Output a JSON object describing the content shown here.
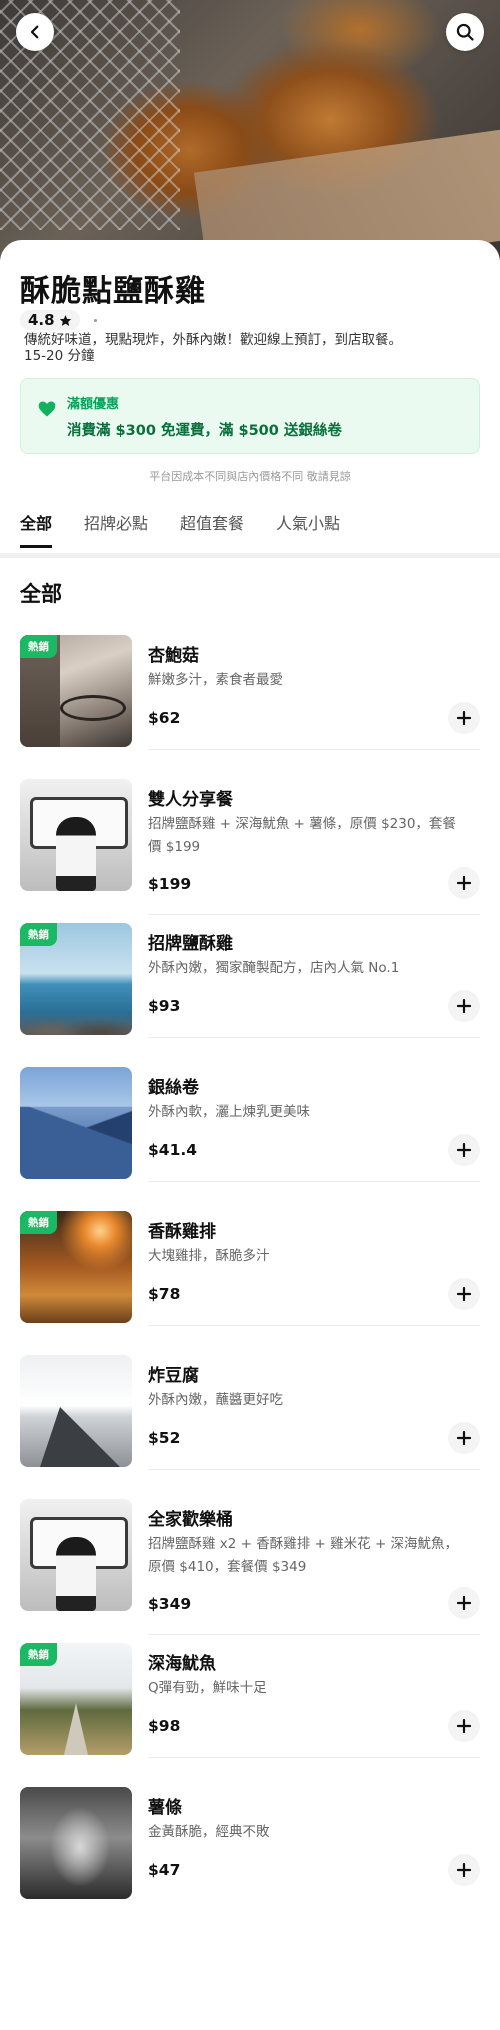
{
  "store": {
    "name": "酥脆點鹽酥雞",
    "rating": "4.8",
    "description": "傳統好味道，現點現炸，外酥內嫩！歡迎線上預訂，到店取餐。",
    "eta": "15-20 分鐘"
  },
  "promo": {
    "title": "滿額優惠",
    "text": "消費滿 $300 免運費，滿 $500 送銀絲卷",
    "accent_color": "#06a45b"
  },
  "disclaimer": "平台因成本不同與店內價格不同 敬請見諒",
  "tabs": [
    {
      "label": "全部"
    },
    {
      "label": "招牌必點"
    },
    {
      "label": "超值套餐"
    },
    {
      "label": "人氣小點"
    }
  ],
  "section_title": "全部",
  "badge_label": "熱銷",
  "icons": {
    "back": "chevron-left-icon",
    "search": "search-icon",
    "rating": "star-icon",
    "promo": "heart-icon",
    "add": "plus-icon"
  },
  "items": [
    {
      "name": "杏鮑菇",
      "desc": "鮮嫩多汁，素食者最愛",
      "price": "$62",
      "hot": true,
      "image": "street-photo"
    },
    {
      "name": "雙人分享餐",
      "desc": "招牌鹽酥雞 + 深海魷魚 + 薯條，原價 $230，套餐價 $199",
      "price": "$199",
      "hot": false,
      "image": "subway-photo"
    },
    {
      "name": "招牌鹽酥雞",
      "desc": "外酥內嫩，獨家醃製配方，店內人氣 No.1",
      "price": "$93",
      "hot": true,
      "image": "sea-photo"
    },
    {
      "name": "銀絲卷",
      "desc": "外酥內軟，灑上煉乳更美味",
      "price": "$41.4",
      "hot": false,
      "image": "mountain-photo"
    },
    {
      "name": "香酥雞排",
      "desc": "大塊雞排，酥脆多汁",
      "price": "$78",
      "hot": true,
      "image": "field-photo"
    },
    {
      "name": "炸豆腐",
      "desc": "外酥內嫩，蘸醬更好吃",
      "price": "$52",
      "hot": false,
      "image": "road-photo"
    },
    {
      "name": "全家歡樂桶",
      "desc": "招牌鹽酥雞 x2 + 香酥雞排 + 雞米花 + 深海魷魚，原價 $410，套餐價 $349",
      "price": "$349",
      "hot": false,
      "image": "subway-photo"
    },
    {
      "name": "深海魷魚",
      "desc": "Q彈有勁，鮮味十足",
      "price": "$98",
      "hot": true,
      "image": "park-photo"
    },
    {
      "name": "薯條",
      "desc": "金黃酥脆，經典不敗",
      "price": "$47",
      "hot": false,
      "image": "forest-photo"
    }
  ]
}
